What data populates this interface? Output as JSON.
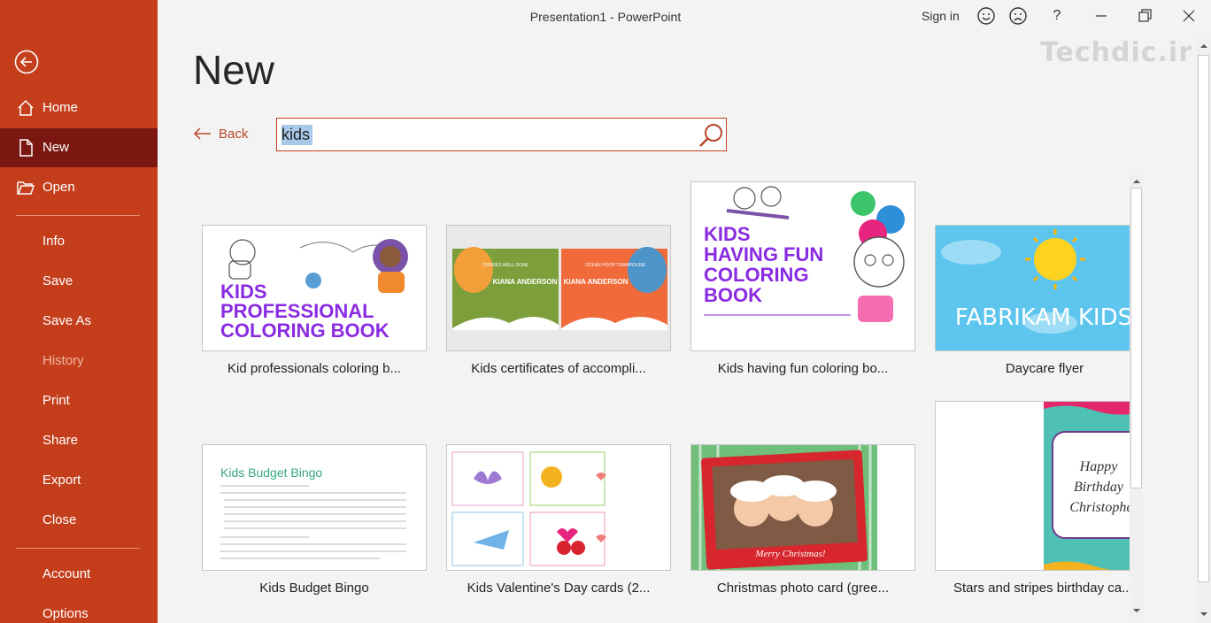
{
  "titlebar": {
    "title": "Presentation1  -  PowerPoint",
    "sign_in": "Sign in",
    "icons": [
      "smile-icon",
      "frown-icon",
      "help-icon",
      "minimize-icon",
      "restore-icon",
      "close-icon"
    ],
    "help_label": "?"
  },
  "watermark": "Techdic.ir",
  "sidebar": {
    "back_icon": "back-arrow-circle-icon",
    "items": [
      {
        "label": "Home",
        "icon": "home-icon"
      },
      {
        "label": "New",
        "icon": "new-document-icon",
        "active": true
      },
      {
        "label": "Open",
        "icon": "open-folder-icon"
      },
      {
        "label": "Info"
      },
      {
        "label": "Save"
      },
      {
        "label": "Save As"
      },
      {
        "label": "History",
        "disabled": true
      },
      {
        "label": "Print"
      },
      {
        "label": "Share"
      },
      {
        "label": "Export"
      },
      {
        "label": "Close"
      },
      {
        "label": "Account"
      },
      {
        "label": "Options"
      }
    ]
  },
  "main": {
    "title": "New",
    "back_label": "Back",
    "search": {
      "value": "kids",
      "icon": "search-icon"
    }
  },
  "templates": [
    {
      "title": "Kid professionals coloring b...",
      "art": {
        "line1": "KIDS",
        "line2": "PROFESSIONAL",
        "line3": "COLORING BOOK"
      }
    },
    {
      "title": "Kids certificates of accompli...",
      "art": {
        "left_heading": "CHORES WELL DONE",
        "left_name": "KIANA ANDERSON",
        "right_heading": "OCEAN HOOP-TRAMPOLINE",
        "right_name": "KIANA ANDERSON"
      }
    },
    {
      "title": "Kids having fun coloring bo...",
      "art": {
        "line1": "KIDS",
        "line2": "HAVING FUN",
        "line3": "COLORING",
        "line4": "BOOK"
      }
    },
    {
      "title": "Daycare flyer",
      "art": {
        "text": "FABRIKAM KIDS"
      }
    },
    {
      "title": "Kids Budget Bingo",
      "art": {
        "heading": "Kids Budget Bingo"
      }
    },
    {
      "title": "Kids Valentine's Day cards (2..."
    },
    {
      "title": "Christmas photo card (gree...",
      "art": {
        "caption": "Merry Christmas!"
      }
    },
    {
      "title": "Stars and stripes birthday ca...",
      "art": {
        "line1": "Happy",
        "line2": "Birthday",
        "line3": "Christopher"
      }
    }
  ],
  "colors": {
    "sidebar": "#c43e1c",
    "sidebar_active": "#7b1711",
    "accent": "#b7472a"
  }
}
